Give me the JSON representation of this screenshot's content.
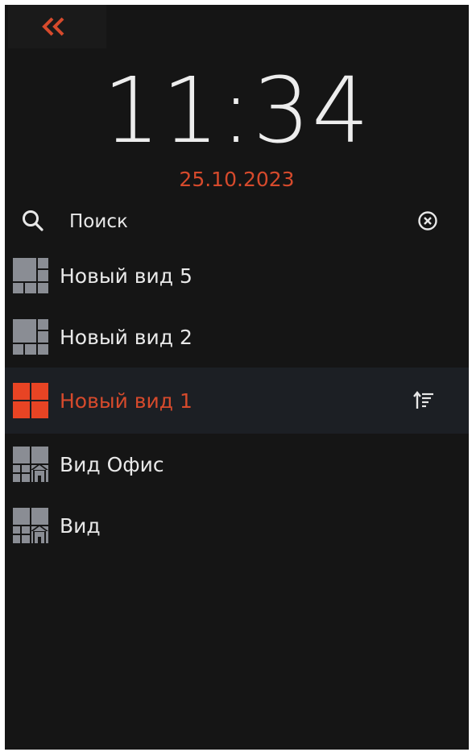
{
  "header": {
    "collapse_icon": "double-chevron-left-icon",
    "accent": "#d64a2c"
  },
  "clock": {
    "time": "11:34",
    "date": "25.10.2023"
  },
  "search": {
    "placeholder": "Поиск",
    "icon": "search-icon",
    "clear_icon": "clear-circle-icon"
  },
  "views": [
    {
      "label": "Новый вид 5",
      "icon": "grid-layout-icon",
      "selected": false
    },
    {
      "label": "Новый вид 2",
      "icon": "grid-layout-icon",
      "selected": false
    },
    {
      "label": "Новый вид 1",
      "icon": "grid-4-layout-icon",
      "selected": true
    },
    {
      "label": "Вид Офис",
      "icon": "grid-home-icon",
      "selected": false
    },
    {
      "label": "Вид",
      "icon": "grid-home-icon",
      "selected": false
    }
  ],
  "sort_icon": "sort-icon"
}
